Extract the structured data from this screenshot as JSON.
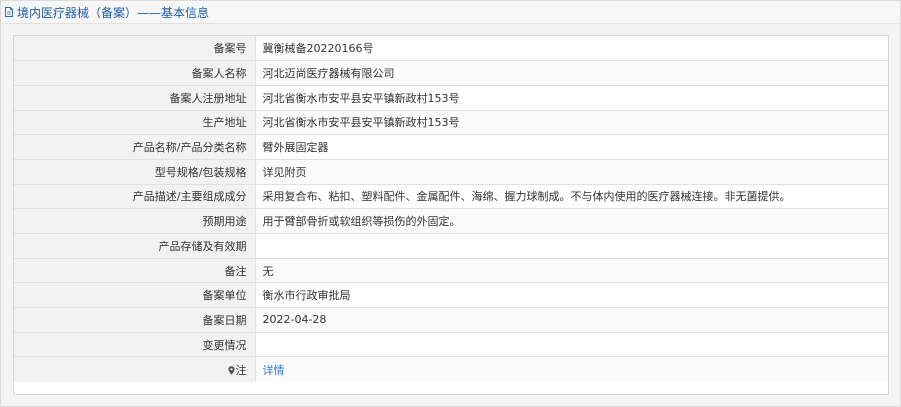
{
  "header": {
    "title": "境内医疗器械（备案）——基本信息",
    "icon": "document-icon"
  },
  "rows": [
    {
      "label": "备案号",
      "value": "冀衡械备20220166号"
    },
    {
      "label": "备案人名称",
      "value": "河北迈尚医疗器械有限公司"
    },
    {
      "label": "备案人注册地址",
      "value": "河北省衡水市安平县安平镇新政村153号"
    },
    {
      "label": "生产地址",
      "value": "河北省衡水市安平县安平镇新政村153号"
    },
    {
      "label": "产品名称/产品分类名称",
      "value": "臂外展固定器"
    },
    {
      "label": "型号规格/包装规格",
      "value": "详见附页"
    },
    {
      "label": "产品描述/主要组成成分",
      "value": "采用复合布、粘扣、塑料配件、金属配件、海绵、握力球制成。不与体内使用的医疗器械连接。非无菌提供。"
    },
    {
      "label": "预期用途",
      "value": "用于臂部骨折或软组织等损伤的外固定。"
    },
    {
      "label": "产品存储及有效期",
      "value": ""
    },
    {
      "label": "备注",
      "value": "无"
    },
    {
      "label": "备案单位",
      "value": "衡水市行政审批局"
    },
    {
      "label": "备案日期",
      "value": "2022-04-28"
    },
    {
      "label": "变更情况",
      "value": ""
    }
  ],
  "note_row": {
    "label": "注",
    "link": "详情",
    "icon": "map-pin-icon"
  },
  "colors": {
    "title": "#1f5fa8",
    "link": "#2b7bd0",
    "label_bg": "#f2f2f2"
  }
}
